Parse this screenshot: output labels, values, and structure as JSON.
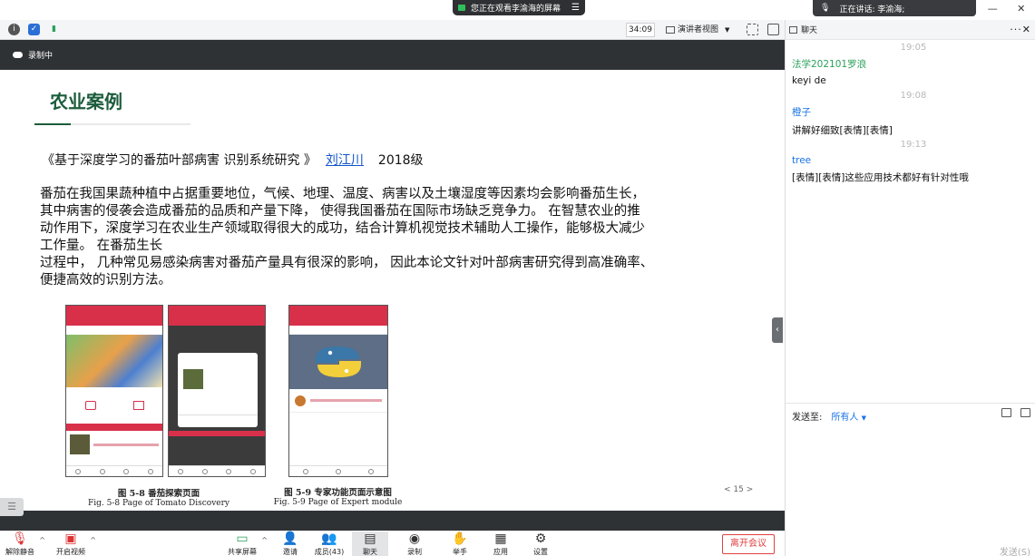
{
  "banner": {
    "text": "您正在观看李渝海的屏幕"
  },
  "speaker": {
    "text": "正在讲话: 李渝海;"
  },
  "toolbar": {
    "timer": "34:09",
    "view_mode": "演讲者视图"
  },
  "slide": {
    "recording_label": "录制中",
    "title": "农业案例",
    "case_title": "《基于深度学习的番茄叶部病害 识别系统研究 》",
    "author": "刘江川",
    "year": "2018级",
    "paragraph_lines": [
      "番茄在我国果蔬种植中占据重要地位，气候、地理、温度、病害以及土壤湿度等因素均会影响番茄生长，",
      "其中病害的侵袭会造成番茄的品质和产量下降， 使得我国番茄在国际市场缺乏竞争力。 在智慧农业的推",
      "动作用下，深度学习在农业生产领域取得很大的成功，结合计算机视觉技术辅助人工操作，能够极大减少",
      "工作量。 在番茄生长",
      "过程中， 几种常见易感染病害对番茄产量具有很深的影响， 因此本论文针对叶部病害研究得到高准确率、",
      "便捷高效的识别方法。"
    ],
    "figures": [
      {
        "zh": "图 5-8  番茄探索页面",
        "en": "Fig. 5-8 Page of Tomato Discovery"
      },
      {
        "zh": "图 5-9  专家功能页面示意图",
        "en": "Fig. 5-9 Page of Expert module"
      }
    ],
    "page_number": "< 15 >"
  },
  "controls": {
    "mute": "解除静音",
    "video": "开启视频",
    "share": "共享屏幕",
    "invite": "邀请",
    "members": "成员(43)",
    "chat": "聊天",
    "record": "录制",
    "raise_hand": "举手",
    "apps": "应用",
    "settings": "设置",
    "leave": "离开会议"
  },
  "chat": {
    "header": "聊天",
    "messages": [
      {
        "time": "19:05",
        "sender": "法学202101罗浪",
        "sender_color": "#2aa15a",
        "text": "keyi de"
      },
      {
        "time": "19:08",
        "sender": "橙子",
        "sender_color": "#1a73e8",
        "text": "讲解好细致[表情][表情]"
      },
      {
        "time": "19:13",
        "sender": "tree",
        "sender_color": "#1a73e8",
        "text": "[表情][表情]这些应用技术都好有针对性哦"
      }
    ],
    "send_to_label": "发送至:",
    "send_target": "所有人",
    "send_button": "发送(S)"
  }
}
